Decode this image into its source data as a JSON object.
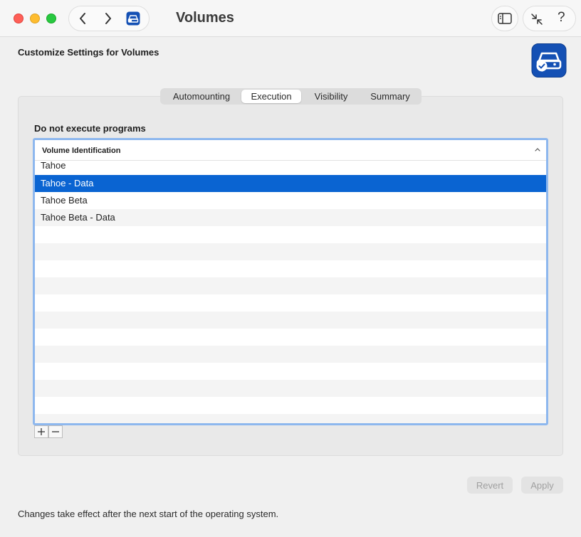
{
  "window": {
    "title": "Volumes"
  },
  "header": {
    "heading": "Customize Settings for Volumes"
  },
  "tabs": [
    {
      "label": "Automounting",
      "selected": false
    },
    {
      "label": "Execution",
      "selected": true
    },
    {
      "label": "Visibility",
      "selected": false
    },
    {
      "label": "Summary",
      "selected": false
    }
  ],
  "section": {
    "label": "Do not execute programs"
  },
  "table": {
    "column": "Volume Identification",
    "rows": [
      {
        "label": "Tahoe",
        "selected": false
      },
      {
        "label": "Tahoe - Data",
        "selected": true
      },
      {
        "label": "Tahoe Beta",
        "selected": false
      },
      {
        "label": "Tahoe Beta - Data",
        "selected": false
      }
    ]
  },
  "footer": {
    "revert_label": "Revert",
    "apply_label": "Apply",
    "note": "Changes take effect after the next start of the operating system."
  },
  "icons": {
    "back": "chevron-left-icon",
    "forward": "chevron-right-icon",
    "sidebar": "sidebar-icon",
    "collapse": "collapse-arrows-icon",
    "help": "?"
  },
  "colors": {
    "selection": "#0a64d2",
    "focus_ring": "#8db7ee",
    "app_icon": "#1450b4"
  }
}
